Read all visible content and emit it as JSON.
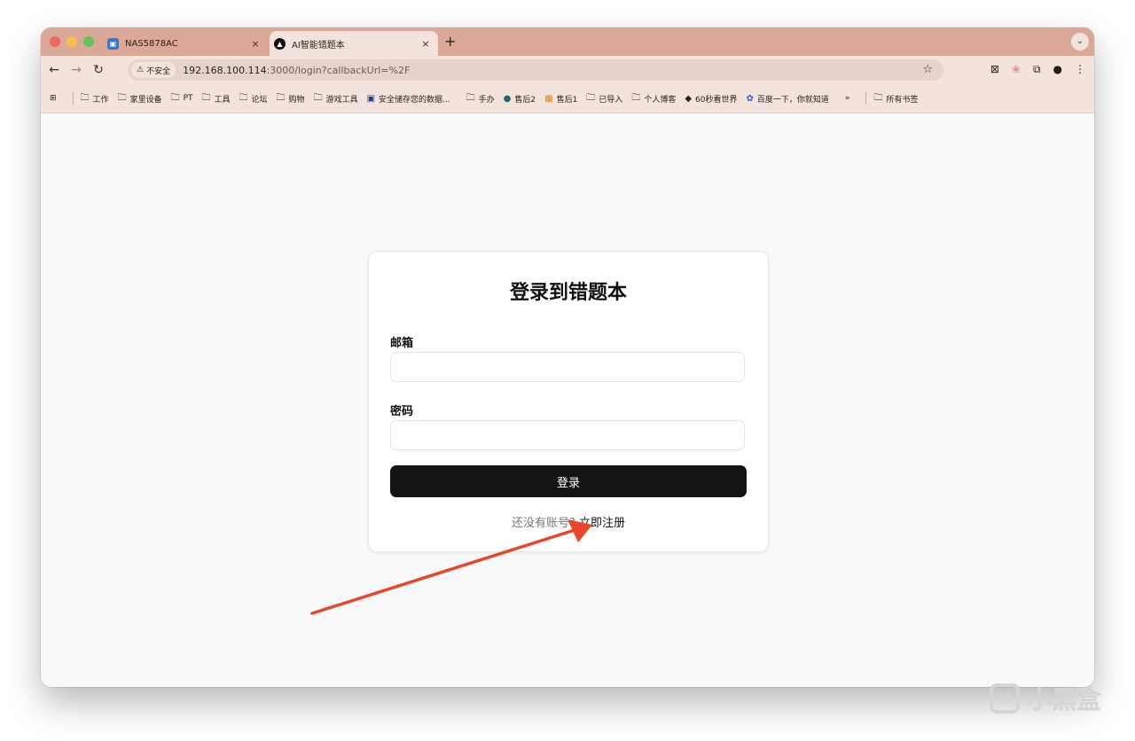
{
  "browser": {
    "tabs": [
      {
        "title": "NAS5878AC",
        "active": false
      },
      {
        "title": "AI智能错题本",
        "active": true
      }
    ],
    "new_tab": "+",
    "close": "×",
    "security_label": "不安全",
    "url_host": "192.168.100.114",
    "url_rest": ":3000/login?callbackUrl=%2F",
    "bookmarks": [
      "工作",
      "家里设备",
      "PT",
      "工具",
      "论坛",
      "购物",
      "游戏工具",
      "安全储存您的数据...",
      "手办",
      "售后2",
      "售后1",
      "已导入",
      "个人博客",
      "60秒看世界",
      "百度一下，你就知道"
    ],
    "bookmarks_more": "»",
    "all_bookmarks": "所有书签"
  },
  "login": {
    "title": "登录到错题本",
    "email_label": "邮箱",
    "email_value": "",
    "password_label": "密码",
    "password_value": "",
    "submit_label": "登录",
    "no_account": "还没有账号?",
    "register_link": "立即注册"
  },
  "watermark": "小黑盒",
  "colors": {
    "tabstrip": "#dba898",
    "toolbar": "#f3e3dd",
    "button": "#141414",
    "arrow": "#e8472a"
  },
  "icons": [
    "back-arrow-icon",
    "forward-arrow-icon",
    "reload-icon",
    "warning-icon",
    "star-icon",
    "folder-icon",
    "apps-grid-icon",
    "extensions-icon",
    "kebab-menu-icon"
  ]
}
